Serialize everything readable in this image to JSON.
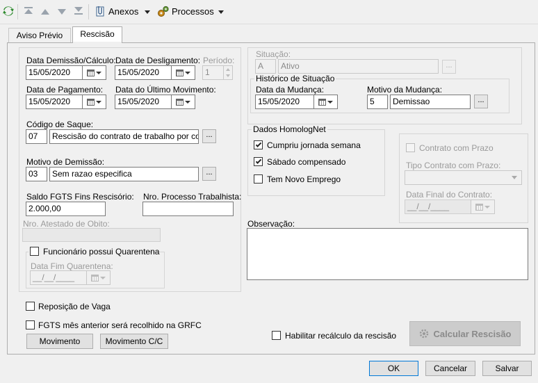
{
  "toolbar": {
    "anexos": "Anexos",
    "processos": "Processos"
  },
  "tabs": [
    {
      "label": "Aviso Prévio"
    },
    {
      "label": "Rescisão"
    }
  ],
  "left": {
    "data_demissao_label": "Data Demissão/Cálculo:",
    "data_demissao_value": "15/05/2020",
    "data_desligamento_label": "Data de Desligamento:",
    "data_desligamento_value": "15/05/2020",
    "periodo_label": "Período:",
    "periodo_value": "1",
    "data_pagamento_label": "Data de Pagamento:",
    "data_pagamento_value": "15/05/2020",
    "data_ultimo_mov_label": "Data do Último Movimento:",
    "data_ultimo_mov_value": "15/05/2020",
    "codigo_saque_label": "Código de Saque:",
    "codigo_saque_code": "07",
    "codigo_saque_desc": "Rescisão do contrato de trabalho por comum",
    "motivo_demissao_label": "Motivo de Demissão:",
    "motivo_demissao_code": "03",
    "motivo_demissao_desc": "Sem razao especifica",
    "saldo_fgts_label": "Saldo FGTS Fins Rescisório:",
    "saldo_fgts_value": "2.000,00",
    "nro_processo_label": "Nro. Processo Trabalhista:",
    "nro_processo_value": "",
    "nro_atestado_label": "Nro. Atestado de Obito:",
    "nro_atestado_value": "",
    "quarentena_label": "Funcionário possui Quarentena",
    "data_fim_quarentena_label": "Data Fim Quarentena:",
    "data_fim_quarentena_value": "__/__/____"
  },
  "situacao": {
    "label": "Situação:",
    "code": "A",
    "desc": "Ativo",
    "historico_legend": "Histórico de Situação",
    "data_mudanca_label": "Data da Mudança:",
    "data_mudanca_value": "15/05/2020",
    "motivo_mudanca_label": "Motivo da Mudança:",
    "motivo_mudanca_code": "5",
    "motivo_mudanca_desc": "Demissao"
  },
  "homolognet": {
    "legend": "Dados HomologNet",
    "items": [
      {
        "label": "Cumpriu jornada semana",
        "checked": true
      },
      {
        "label": "Sábado compensado",
        "checked": true
      },
      {
        "label": "Tem Novo Emprego",
        "checked": false
      }
    ]
  },
  "contrato": {
    "prazo_label": "Contrato com Prazo",
    "tipo_label": "Tipo Contrato com Prazo:",
    "data_final_label": "Data Final do Contrato:",
    "data_final_value": "__/__/____"
  },
  "observacao_label": "Observação:",
  "bottom": {
    "reposicao_label": "Reposição de Vaga",
    "fgts_label": "FGTS mês anterior será recolhido na GRFC",
    "movimento_btn": "Movimento",
    "movimento_cc_btn": "Movimento C/C",
    "habilitar_label": "Habilitar recálculo da rescisão",
    "calcular_btn": "Calcular Rescisão"
  },
  "footer": {
    "ok": "OK",
    "cancelar": "Cancelar",
    "salvar": "Salvar"
  }
}
